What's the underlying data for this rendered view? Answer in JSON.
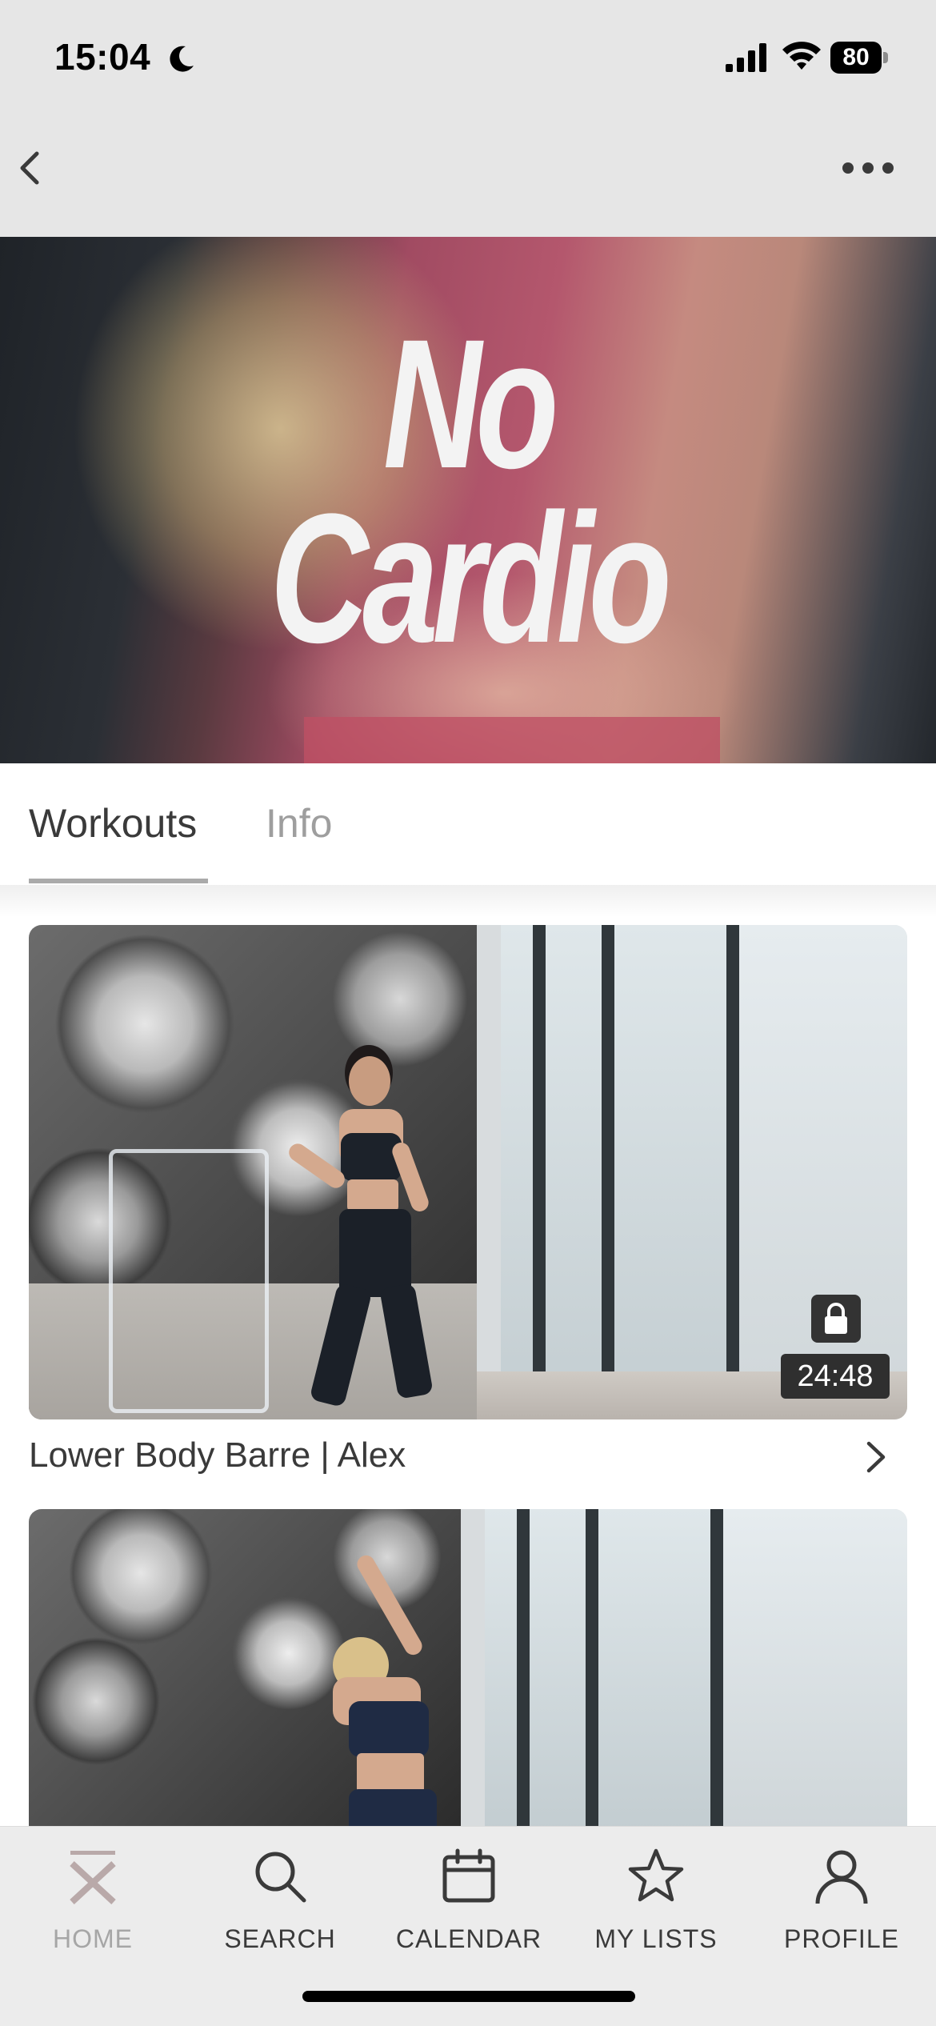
{
  "status_bar": {
    "time": "15:04",
    "battery": "80"
  },
  "hero": {
    "title_line1": "No",
    "title_line2": "Cardio"
  },
  "tabs": [
    {
      "label": "Workouts",
      "active": true
    },
    {
      "label": "Info",
      "active": false
    }
  ],
  "workouts": [
    {
      "title": "Lower Body Barre | Alex",
      "duration": "24:48",
      "locked": true
    }
  ],
  "bottom_nav": [
    {
      "label": "HOME",
      "icon": "home-logo-icon",
      "active": true
    },
    {
      "label": "SEARCH",
      "icon": "search-icon",
      "active": false
    },
    {
      "label": "CALENDAR",
      "icon": "calendar-icon",
      "active": false
    },
    {
      "label": "MY LISTS",
      "icon": "star-icon",
      "active": false
    },
    {
      "label": "PROFILE",
      "icon": "profile-icon",
      "active": false
    }
  ],
  "colors": {
    "bar_background": "#e6e6e6",
    "active_tab_underline": "#aaaaaa",
    "inactive_nav_label": "#a6a6a6"
  }
}
